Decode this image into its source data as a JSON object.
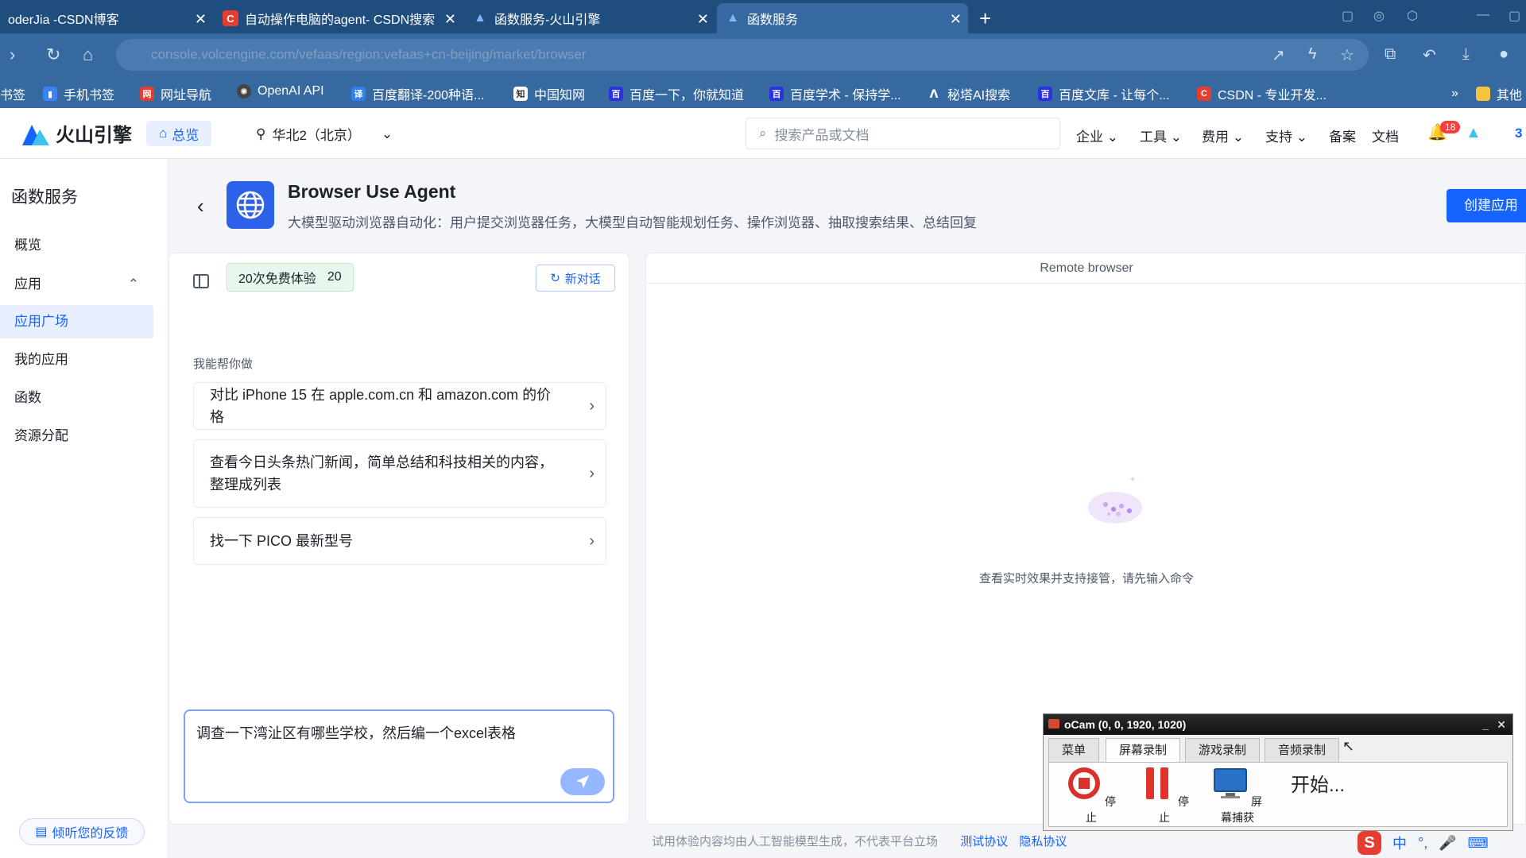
{
  "browser": {
    "tabs": [
      {
        "title": "oderJia -CSDN博客",
        "favicon": "csdn"
      },
      {
        "title": "自动操作电脑的agent- CSDN搜索",
        "favicon": "csdn"
      },
      {
        "title": "函数服务-火山引擎",
        "favicon": "volcengine"
      },
      {
        "title": "函数服务",
        "favicon": "volcengine",
        "active": true
      }
    ],
    "url": "console.volcengine.com/vefaas/region:vefaas+cn-beijing/market/browser",
    "bookmarks": [
      "书签",
      "手机书签",
      "网址导航",
      "OpenAI API",
      "百度翻译-200种语...",
      "中国知网",
      "百度一下，你就知道",
      "百度学术 - 保持学...",
      "秘塔AI搜索",
      "百度文库 - 让每个...",
      "CSDN - 专业开发...",
      "其他"
    ]
  },
  "header": {
    "logo_text": "火山引擎",
    "home_label": "总览",
    "region": "华北2（北京）",
    "search_placeholder": "搜索产品或文档",
    "nav": [
      "企业",
      "工具",
      "费用",
      "支持",
      "备案",
      "文档"
    ],
    "notification_count": "18",
    "extra": "3"
  },
  "sidebar": {
    "title": "函数服务",
    "items": [
      {
        "label": "概览"
      },
      {
        "label": "应用"
      },
      {
        "label": "应用广场",
        "active": true
      },
      {
        "label": "我的应用"
      },
      {
        "label": "函数"
      },
      {
        "label": "资源分配"
      }
    ],
    "feedback": "倾听您的反馈"
  },
  "app": {
    "title": "Browser Use Agent",
    "description": "大模型驱动浏览器自动化：用户提交浏览器任务，大模型自动智能规划任务、操作浏览器、抽取搜索结果、总结回复",
    "create_button": "创建应用"
  },
  "chat": {
    "trial_label": "20次免费体验",
    "trial_count": "20",
    "new_chat": "新对话",
    "help_label": "我能帮你做",
    "suggestions": [
      "对比 iPhone 15 在 apple.com.cn 和 amazon.com 的价格",
      "查看今日头条热门新闻，简单总结和科技相关的内容，整理成列表",
      "找一下 PICO 最新型号"
    ],
    "input_value": "调查一下湾沚区有哪些学校，然后编一个excel表格"
  },
  "remote": {
    "title": "Remote browser",
    "hint": "查看实时效果并支持接管，请先输入命令"
  },
  "footer": {
    "notice": "试用体验内容均由人工智能模型生成，不代表平台立场",
    "links": [
      "测试协议",
      "隐私协议"
    ]
  },
  "ocam": {
    "title": "oCam (0, 0, 1920, 1020)",
    "tabs": [
      "菜单",
      "屏幕录制",
      "游戏录制",
      "音频录制"
    ],
    "active_tab": "屏幕录制",
    "buttons": [
      "停止",
      "停止",
      "屏幕捕获"
    ],
    "status": "开始..."
  },
  "taskbar": {
    "ime": "中"
  }
}
